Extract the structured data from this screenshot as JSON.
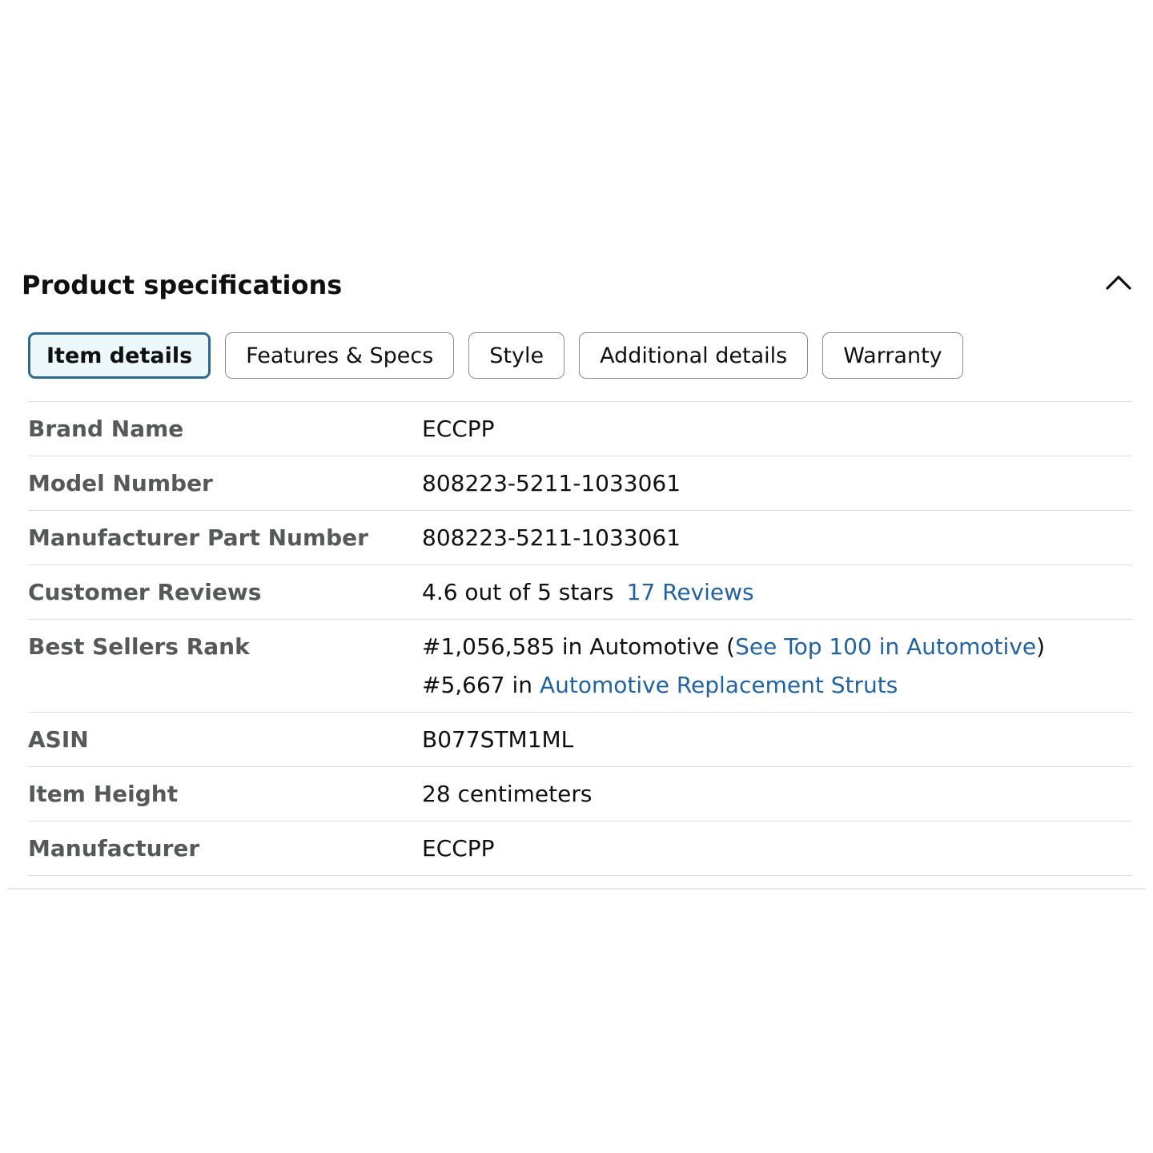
{
  "section": {
    "title": "Product specifications",
    "toggle_icon": "chevron-up-icon"
  },
  "tabs": [
    {
      "label": "Item details",
      "active": true
    },
    {
      "label": "Features & Specs",
      "active": false
    },
    {
      "label": "Style",
      "active": false
    },
    {
      "label": "Additional details",
      "active": false
    },
    {
      "label": "Warranty",
      "active": false
    }
  ],
  "specs": {
    "brand_name": {
      "label": "Brand Name",
      "value": "ECCPP"
    },
    "model_number": {
      "label": "Model Number",
      "value": "808223-5211-1033061"
    },
    "manufacturer_part_number": {
      "label": "Manufacturer Part Number",
      "value": "808223-5211-1033061"
    },
    "customer_reviews": {
      "label": "Customer Reviews",
      "rating_text": "4.6 out of 5 stars",
      "reviews_link": "17 Reviews"
    },
    "best_sellers_rank": {
      "label": "Best Sellers Rank",
      "rank1_prefix": "#1,056,585 in Automotive (",
      "rank1_link": "See Top 100 in Automotive",
      "rank1_suffix": ")",
      "rank2_prefix": "#5,667 in ",
      "rank2_link": "Automotive Replacement Struts"
    },
    "asin": {
      "label": "ASIN",
      "value": "B077STM1ML"
    },
    "item_height": {
      "label": "Item Height",
      "value": "28 centimeters"
    },
    "manufacturer": {
      "label": "Manufacturer",
      "value": "ECCPP"
    }
  },
  "colors": {
    "link": "#2162a1",
    "active_tab_border": "#2c6b8f",
    "active_tab_bg": "#edf8fd",
    "label_text": "#565959"
  }
}
